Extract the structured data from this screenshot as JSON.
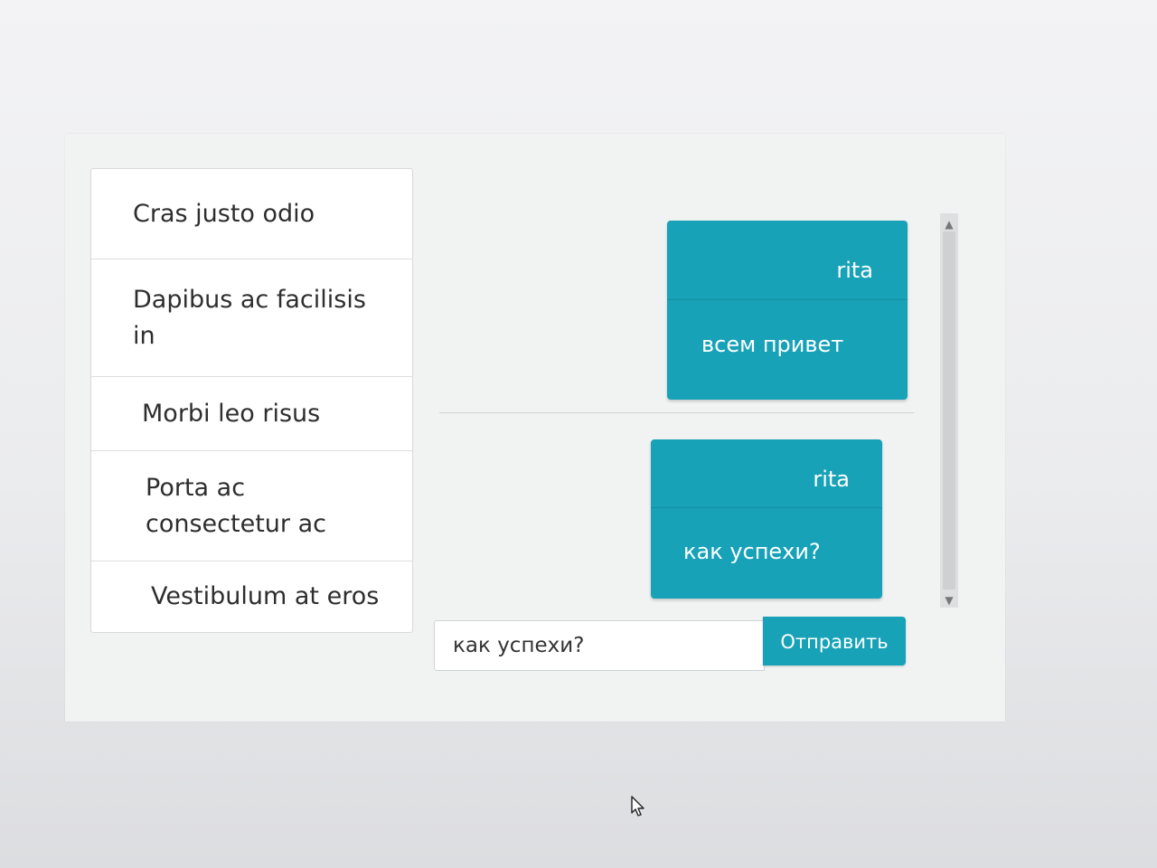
{
  "sidebar": {
    "items": [
      {
        "label": "Cras justo odio"
      },
      {
        "label": "Dapibus ac facilisis in"
      },
      {
        "label": "Morbi leo risus"
      },
      {
        "label": "Porta ac consectetur ac"
      },
      {
        "label": "Vestibulum at eros"
      }
    ]
  },
  "chat": {
    "messages": [
      {
        "author": "rita",
        "text": "всем привет"
      },
      {
        "author": "rita",
        "text": "как успехи?"
      }
    ]
  },
  "composer": {
    "value": "как успехи?",
    "send_label": "Отправить"
  },
  "colors": {
    "accent": "#17a2b8"
  },
  "icons": {
    "scroll_up": "scroll-up-arrow-icon",
    "scroll_down": "scroll-down-arrow-icon",
    "pointer": "mouse-pointer-icon"
  }
}
